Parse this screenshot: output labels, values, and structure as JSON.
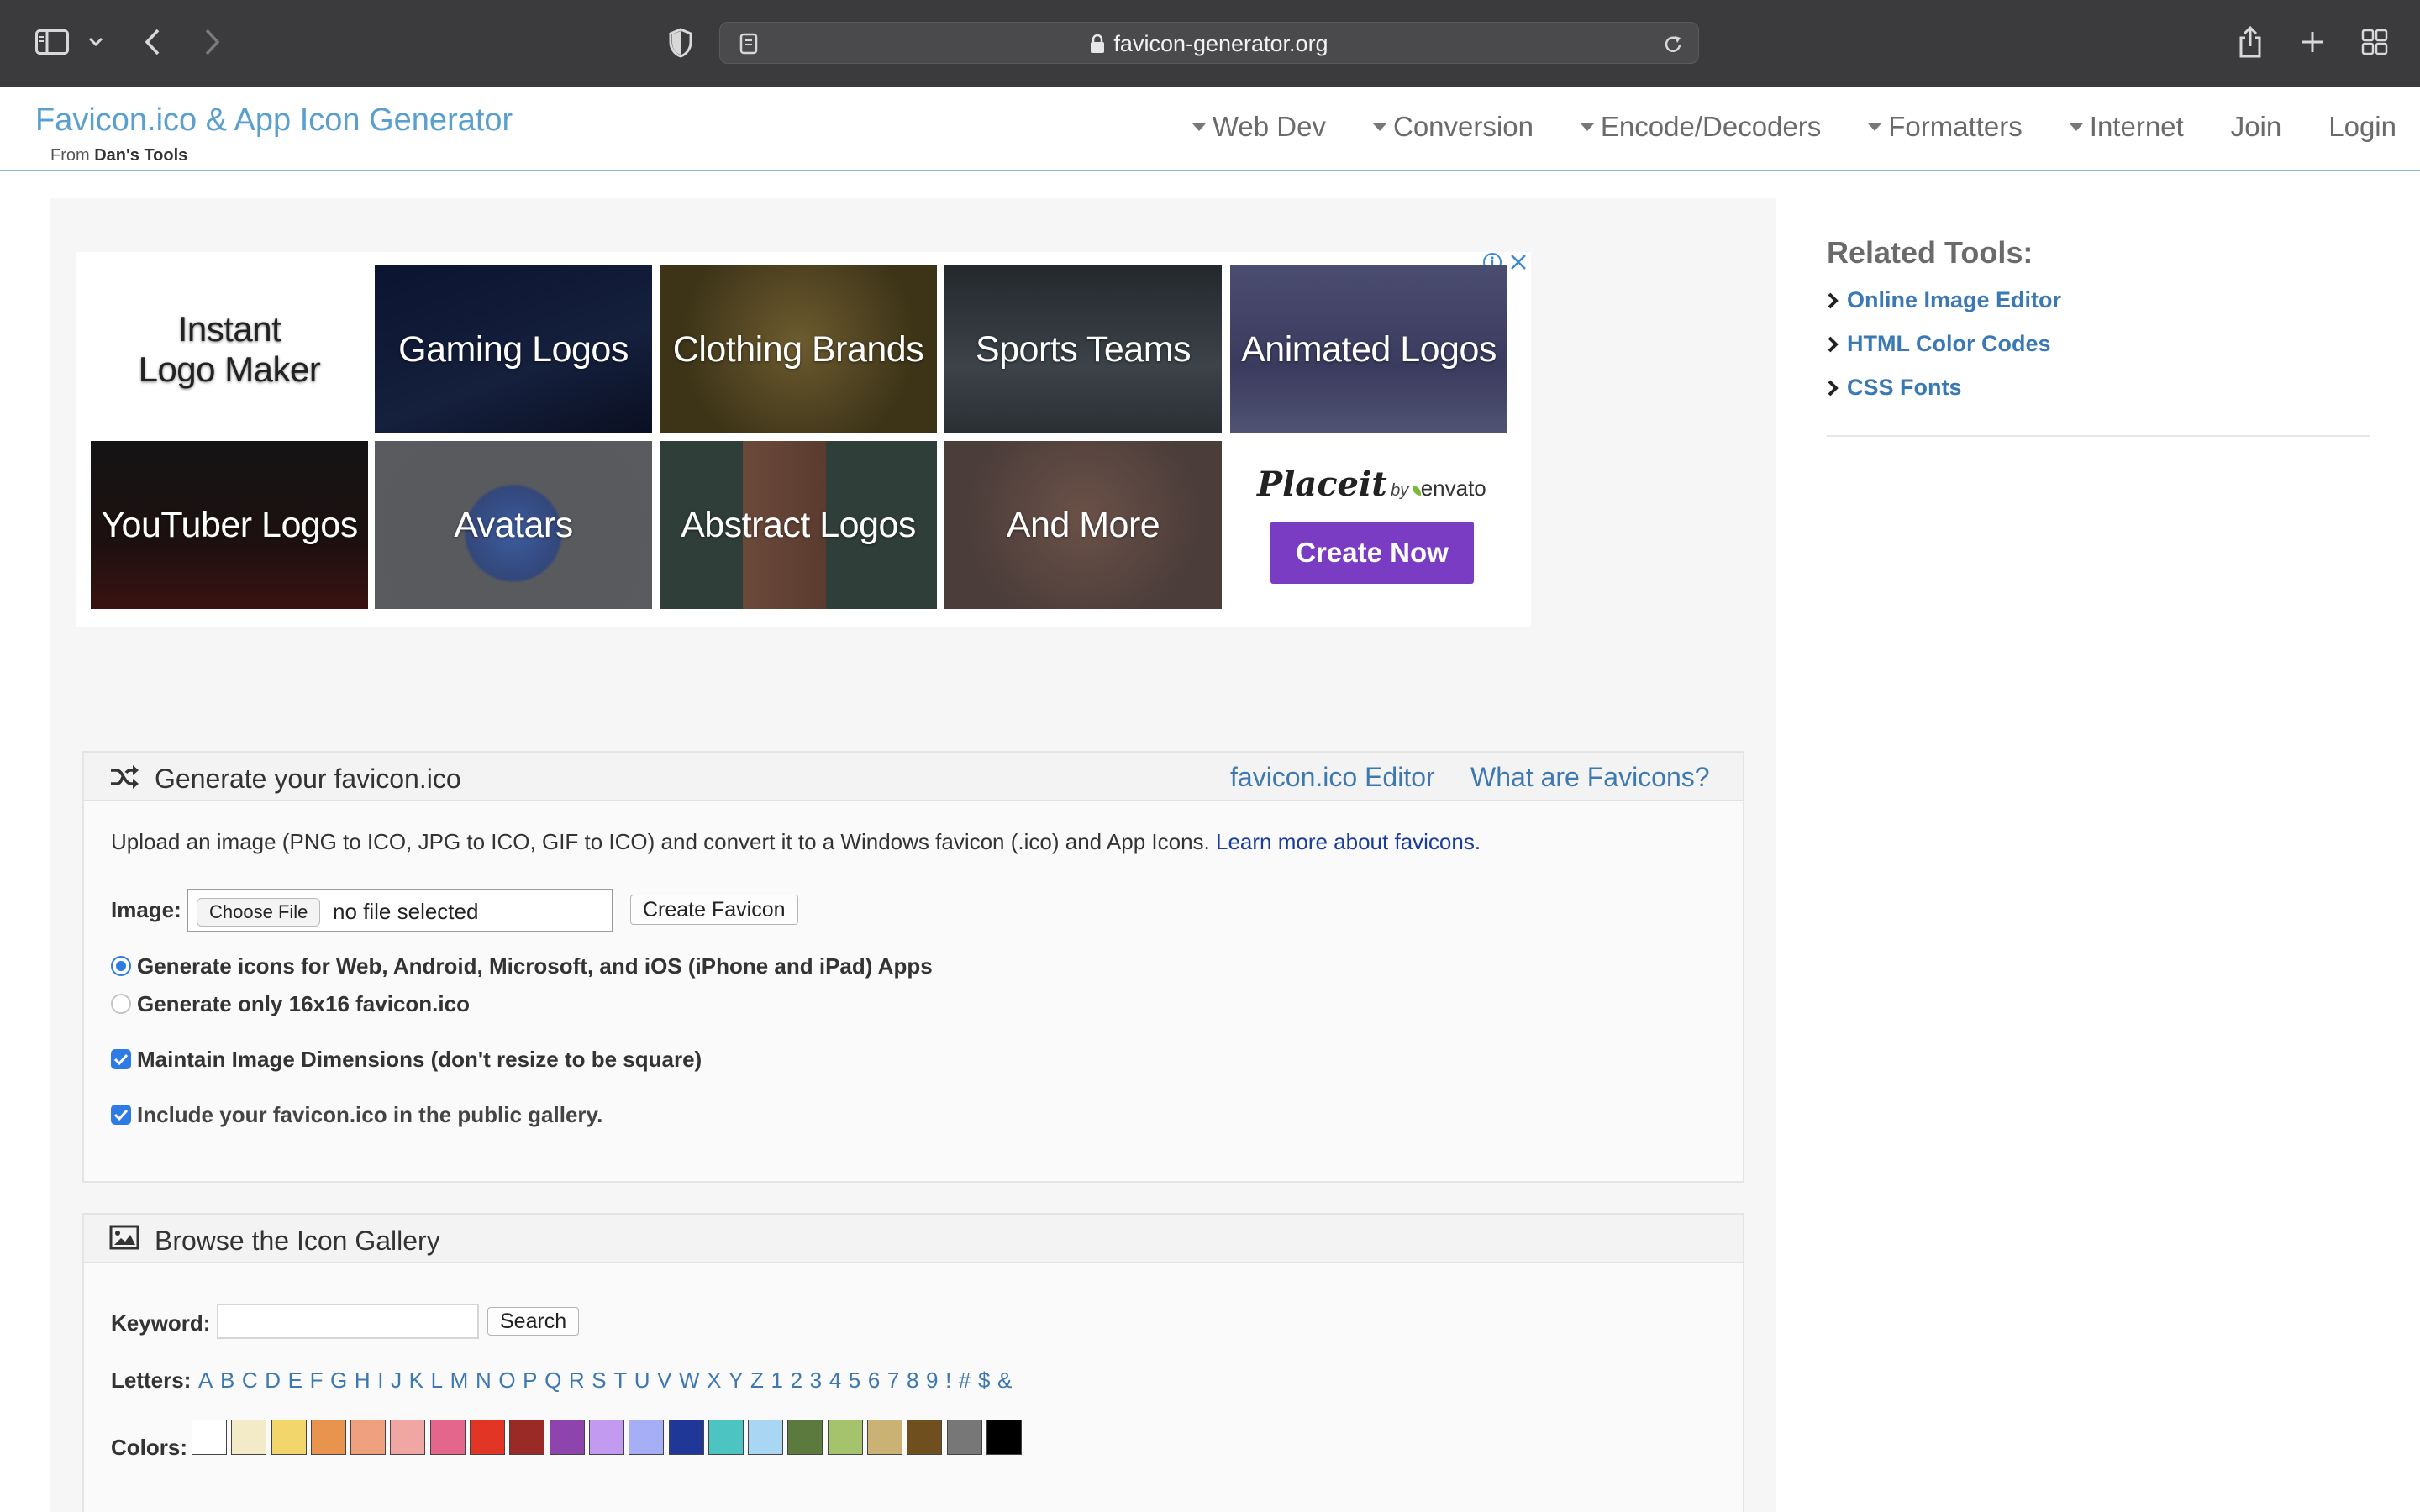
{
  "browser": {
    "url": "favicon-generator.org"
  },
  "header": {
    "brand": "Favicon.ico & App Icon Generator",
    "from_prefix": "From",
    "from_name": "Dan's Tools",
    "nav": [
      "Web Dev",
      "Conversion",
      "Encode/Decoders",
      "Formatters",
      "Internet"
    ],
    "join": "Join",
    "login": "Login"
  },
  "ad": {
    "instant_line1": "Instant",
    "instant_line2": "Logo Maker",
    "tiles": [
      "Gaming Logos",
      "Clothing Brands",
      "Sports Teams",
      "Animated Logos",
      "YouTuber Logos",
      "Avatars",
      "Abstract Logos",
      "And More"
    ],
    "placeit": "Placeit",
    "by": "by",
    "envato": "envato",
    "cta": "Create Now"
  },
  "generate": {
    "title": "Generate your favicon.ico",
    "editor_link": "favicon.ico Editor",
    "what_link": "What are Favicons?",
    "description": "Upload an image (PNG to ICO, JPG to ICO, GIF to ICO) and convert it to a Windows favicon (.ico) and App Icons.",
    "learn_more": "Learn more about favicons.",
    "image_label": "Image:",
    "choose_file": "Choose File",
    "no_file": "no file selected",
    "create_button": "Create Favicon",
    "option_all": "Generate icons for Web, Android, Microsoft, and iOS (iPhone and iPad) Apps",
    "option_16": "Generate only 16x16 favicon.ico",
    "maintain": "Maintain Image Dimensions (don't resize to be square)",
    "include": "Include your favicon.ico in the public gallery."
  },
  "gallery": {
    "title": "Browse the Icon Gallery",
    "keyword_label": "Keyword:",
    "search_button": "Search",
    "letters_label": "Letters:",
    "letters": [
      "A",
      "B",
      "C",
      "D",
      "E",
      "F",
      "G",
      "H",
      "I",
      "J",
      "K",
      "L",
      "M",
      "N",
      "O",
      "P",
      "Q",
      "R",
      "S",
      "T",
      "U",
      "V",
      "W",
      "X",
      "Y",
      "Z",
      "1",
      "2",
      "3",
      "4",
      "5",
      "6",
      "7",
      "8",
      "9",
      "!",
      "#",
      "$",
      "&"
    ],
    "colors_label": "Colors:",
    "colors": [
      "#ffffff",
      "#f3ebc8",
      "#f2d56b",
      "#e8934e",
      "#efa07e",
      "#f0a7a3",
      "#e5668c",
      "#e33526",
      "#9a2a25",
      "#8e44ad",
      "#c29af0",
      "#a6aef5",
      "#1f3796",
      "#4cc4c1",
      "#a8d6f3",
      "#5c7a3e",
      "#a5c26d",
      "#c9b274",
      "#6e4f1d",
      "#777777",
      "#000000"
    ]
  },
  "sidebar": {
    "title": "Related Tools:",
    "items": [
      "Online Image Editor",
      "HTML Color Codes",
      "CSS Fonts"
    ]
  }
}
